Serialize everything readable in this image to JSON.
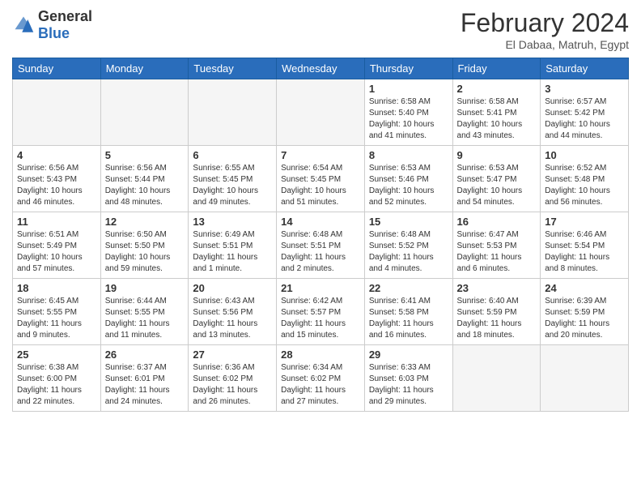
{
  "logo": {
    "general": "General",
    "blue": "Blue"
  },
  "title": "February 2024",
  "location": "El Dabaa, Matruh, Egypt",
  "headers": [
    "Sunday",
    "Monday",
    "Tuesday",
    "Wednesday",
    "Thursday",
    "Friday",
    "Saturday"
  ],
  "weeks": [
    [
      {
        "day": "",
        "info": ""
      },
      {
        "day": "",
        "info": ""
      },
      {
        "day": "",
        "info": ""
      },
      {
        "day": "",
        "info": ""
      },
      {
        "day": "1",
        "info": "Sunrise: 6:58 AM\nSunset: 5:40 PM\nDaylight: 10 hours and 41 minutes."
      },
      {
        "day": "2",
        "info": "Sunrise: 6:58 AM\nSunset: 5:41 PM\nDaylight: 10 hours and 43 minutes."
      },
      {
        "day": "3",
        "info": "Sunrise: 6:57 AM\nSunset: 5:42 PM\nDaylight: 10 hours and 44 minutes."
      }
    ],
    [
      {
        "day": "4",
        "info": "Sunrise: 6:56 AM\nSunset: 5:43 PM\nDaylight: 10 hours and 46 minutes."
      },
      {
        "day": "5",
        "info": "Sunrise: 6:56 AM\nSunset: 5:44 PM\nDaylight: 10 hours and 48 minutes."
      },
      {
        "day": "6",
        "info": "Sunrise: 6:55 AM\nSunset: 5:45 PM\nDaylight: 10 hours and 49 minutes."
      },
      {
        "day": "7",
        "info": "Sunrise: 6:54 AM\nSunset: 5:45 PM\nDaylight: 10 hours and 51 minutes."
      },
      {
        "day": "8",
        "info": "Sunrise: 6:53 AM\nSunset: 5:46 PM\nDaylight: 10 hours and 52 minutes."
      },
      {
        "day": "9",
        "info": "Sunrise: 6:53 AM\nSunset: 5:47 PM\nDaylight: 10 hours and 54 minutes."
      },
      {
        "day": "10",
        "info": "Sunrise: 6:52 AM\nSunset: 5:48 PM\nDaylight: 10 hours and 56 minutes."
      }
    ],
    [
      {
        "day": "11",
        "info": "Sunrise: 6:51 AM\nSunset: 5:49 PM\nDaylight: 10 hours and 57 minutes."
      },
      {
        "day": "12",
        "info": "Sunrise: 6:50 AM\nSunset: 5:50 PM\nDaylight: 10 hours and 59 minutes."
      },
      {
        "day": "13",
        "info": "Sunrise: 6:49 AM\nSunset: 5:51 PM\nDaylight: 11 hours and 1 minute."
      },
      {
        "day": "14",
        "info": "Sunrise: 6:48 AM\nSunset: 5:51 PM\nDaylight: 11 hours and 2 minutes."
      },
      {
        "day": "15",
        "info": "Sunrise: 6:48 AM\nSunset: 5:52 PM\nDaylight: 11 hours and 4 minutes."
      },
      {
        "day": "16",
        "info": "Sunrise: 6:47 AM\nSunset: 5:53 PM\nDaylight: 11 hours and 6 minutes."
      },
      {
        "day": "17",
        "info": "Sunrise: 6:46 AM\nSunset: 5:54 PM\nDaylight: 11 hours and 8 minutes."
      }
    ],
    [
      {
        "day": "18",
        "info": "Sunrise: 6:45 AM\nSunset: 5:55 PM\nDaylight: 11 hours and 9 minutes."
      },
      {
        "day": "19",
        "info": "Sunrise: 6:44 AM\nSunset: 5:55 PM\nDaylight: 11 hours and 11 minutes."
      },
      {
        "day": "20",
        "info": "Sunrise: 6:43 AM\nSunset: 5:56 PM\nDaylight: 11 hours and 13 minutes."
      },
      {
        "day": "21",
        "info": "Sunrise: 6:42 AM\nSunset: 5:57 PM\nDaylight: 11 hours and 15 minutes."
      },
      {
        "day": "22",
        "info": "Sunrise: 6:41 AM\nSunset: 5:58 PM\nDaylight: 11 hours and 16 minutes."
      },
      {
        "day": "23",
        "info": "Sunrise: 6:40 AM\nSunset: 5:59 PM\nDaylight: 11 hours and 18 minutes."
      },
      {
        "day": "24",
        "info": "Sunrise: 6:39 AM\nSunset: 5:59 PM\nDaylight: 11 hours and 20 minutes."
      }
    ],
    [
      {
        "day": "25",
        "info": "Sunrise: 6:38 AM\nSunset: 6:00 PM\nDaylight: 11 hours and 22 minutes."
      },
      {
        "day": "26",
        "info": "Sunrise: 6:37 AM\nSunset: 6:01 PM\nDaylight: 11 hours and 24 minutes."
      },
      {
        "day": "27",
        "info": "Sunrise: 6:36 AM\nSunset: 6:02 PM\nDaylight: 11 hours and 26 minutes."
      },
      {
        "day": "28",
        "info": "Sunrise: 6:34 AM\nSunset: 6:02 PM\nDaylight: 11 hours and 27 minutes."
      },
      {
        "day": "29",
        "info": "Sunrise: 6:33 AM\nSunset: 6:03 PM\nDaylight: 11 hours and 29 minutes."
      },
      {
        "day": "",
        "info": ""
      },
      {
        "day": "",
        "info": ""
      }
    ]
  ]
}
